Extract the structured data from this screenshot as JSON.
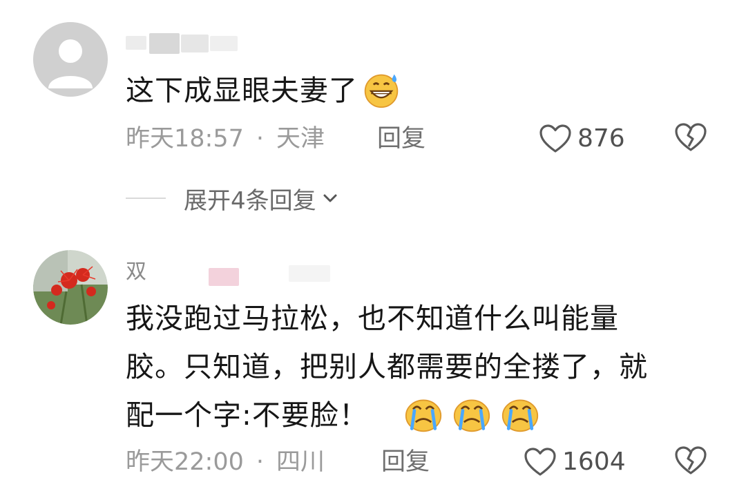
{
  "comments": [
    {
      "username": "",
      "text": "这下成显眼夫妻了",
      "emojis": [
        "grinning-sweat-emoji"
      ],
      "time": "昨天18:57",
      "separator": "·",
      "location": "天津",
      "reply_label": "回复",
      "like_count": "876",
      "expand_label": "展开4条回复"
    },
    {
      "username": "双",
      "text_lines": [
        "我没跑过马拉松，也不知道什么叫能量",
        "胶。只知道，把别人都需要的全搂了，就",
        "配一个字:不要脸！"
      ],
      "emojis": [
        "crying-face-emoji",
        "crying-face-emoji",
        "crying-face-emoji"
      ],
      "time": "昨天22:00",
      "separator": "·",
      "location": "四川",
      "reply_label": "回复",
      "like_count": "1604"
    }
  ],
  "colors": {
    "meta_text": "#9a9a9a",
    "body_text": "#161616",
    "avatar_default": "#d6d6d6",
    "icon_stroke": "#5a5a5a"
  }
}
